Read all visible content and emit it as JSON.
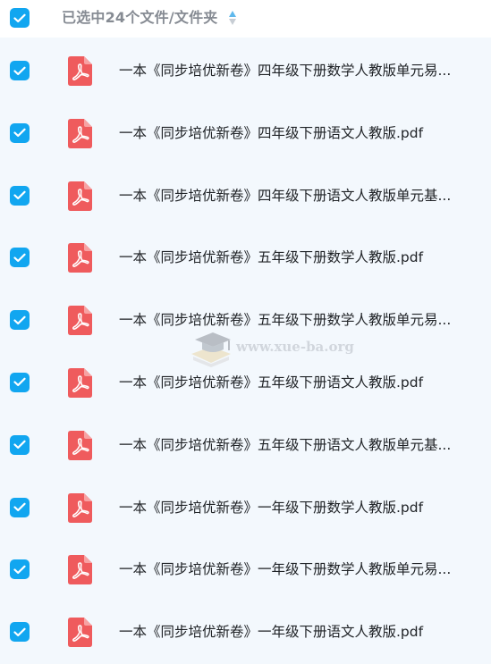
{
  "header": {
    "selection_label": "已选中24个文件/文件夹",
    "checkbox_state": "checked",
    "sort_icon": "sort-icon"
  },
  "files": [
    {
      "name": "一本《同步培优新卷》四年级下册数学人教版单元易...",
      "type": "pdf",
      "checked": true
    },
    {
      "name": "一本《同步培优新卷》四年级下册语文人教版.pdf",
      "type": "pdf",
      "checked": true
    },
    {
      "name": "一本《同步培优新卷》四年级下册语文人教版单元基...",
      "type": "pdf",
      "checked": true
    },
    {
      "name": "一本《同步培优新卷》五年级下册数学人教版.pdf",
      "type": "pdf",
      "checked": true
    },
    {
      "name": "一本《同步培优新卷》五年级下册数学人教版单元易...",
      "type": "pdf",
      "checked": true
    },
    {
      "name": "一本《同步培优新卷》五年级下册语文人教版.pdf",
      "type": "pdf",
      "checked": true
    },
    {
      "name": "一本《同步培优新卷》五年级下册语文人教版单元基...",
      "type": "pdf",
      "checked": true
    },
    {
      "name": "一本《同步培优新卷》一年级下册数学人教版.pdf",
      "type": "pdf",
      "checked": true
    },
    {
      "name": "一本《同步培优新卷》一年级下册数学人教版单元易...",
      "type": "pdf",
      "checked": true
    },
    {
      "name": "一本《同步培优新卷》一年级下册语文人教版.pdf",
      "type": "pdf",
      "checked": true
    }
  ],
  "watermark": {
    "text": "www.xue-ba.org",
    "logo": "graduation-cap-book-logo"
  },
  "colors": {
    "checkbox": "#11a6f0",
    "pdf_icon": "#ef5b5d",
    "list_background": "#f3f8fd",
    "header_background": "#ffffff",
    "header_text": "#868b93",
    "file_text": "#202327"
  }
}
